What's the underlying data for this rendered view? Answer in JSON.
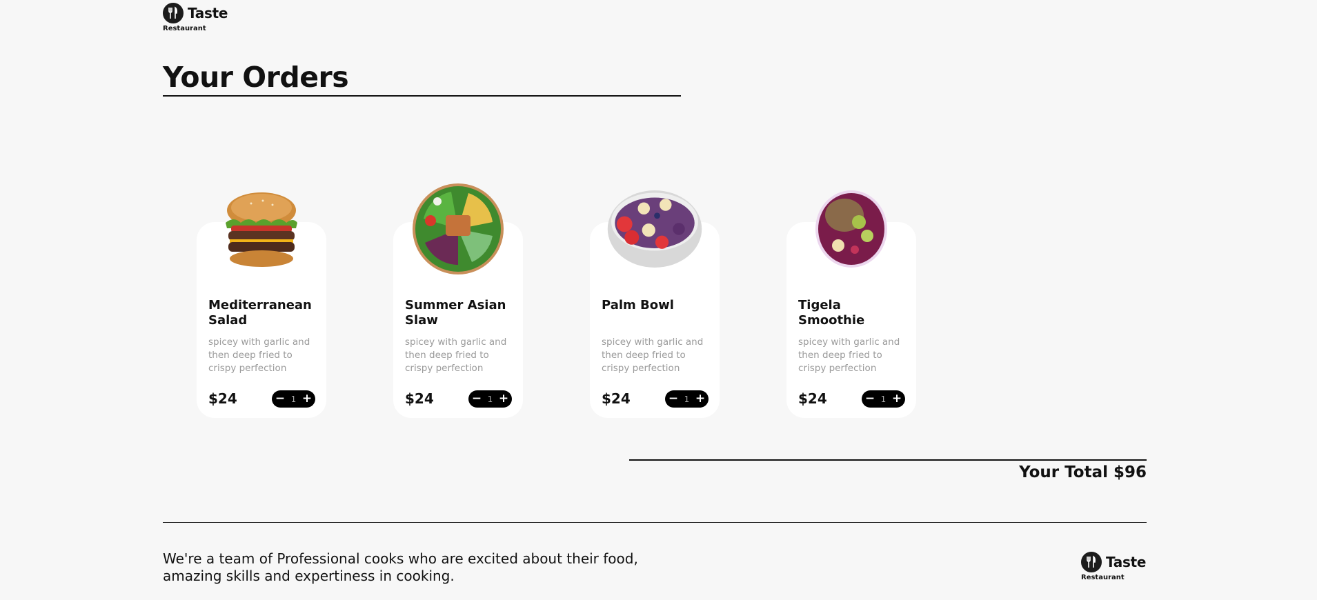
{
  "brand": {
    "name": "Taste",
    "sub": "Restaurant"
  },
  "page_title": "Your Orders",
  "orders": [
    {
      "name": "Mediterranean Salad",
      "desc": "spicey with garlic and then deep fried to crispy perfection",
      "price": "$24",
      "qty": "1",
      "image": "burger-image"
    },
    {
      "name": "Summer Asian Slaw",
      "desc": "spicey with garlic and then deep fried to crispy perfection",
      "price": "$24",
      "qty": "1",
      "image": "salad-bowl-image"
    },
    {
      "name": "Palm Bowl",
      "desc": "spicey with garlic and then deep fried to crispy perfection",
      "price": "$24",
      "qty": "1",
      "image": "fruit-bowl-image"
    },
    {
      "name": "Tigela Smoothie",
      "desc": "spicey with garlic and then deep fried to crispy perfection",
      "price": "$24",
      "qty": "1",
      "image": "smoothie-bowl-image"
    }
  ],
  "stepper": {
    "minus": "−",
    "plus": "+"
  },
  "total_label": "Your Total $96",
  "footer": {
    "about": "We're a team of Professional cooks who are excited about their food, amazing skills and expertiness in cooking."
  }
}
